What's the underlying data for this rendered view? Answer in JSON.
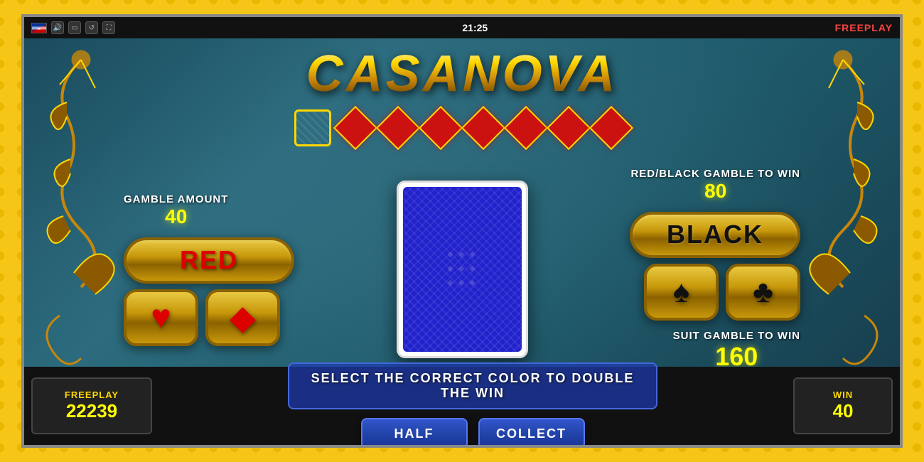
{
  "topbar": {
    "time": "21:25",
    "mode": "FREEPLAY"
  },
  "title": "CASANOVA",
  "card_history": {
    "slots": [
      {
        "type": "back",
        "label": "card-back"
      },
      {
        "type": "diamond",
        "label": "diamond-1"
      },
      {
        "type": "diamond",
        "label": "diamond-2"
      },
      {
        "type": "diamond",
        "label": "diamond-3"
      },
      {
        "type": "diamond",
        "label": "diamond-4"
      },
      {
        "type": "diamond",
        "label": "diamond-5"
      },
      {
        "type": "diamond",
        "label": "diamond-6"
      },
      {
        "type": "diamond",
        "label": "diamond-7"
      }
    ]
  },
  "gamble": {
    "amount_label": "GAMBLE AMOUNT",
    "amount_value": "40",
    "red_black_label": "RED/BLACK GAMBLE TO WIN",
    "red_black_value": "80",
    "suit_label": "SUIT GAMBLE TO WIN",
    "suit_value": "160"
  },
  "buttons": {
    "red_label": "RED",
    "black_label": "BLACK",
    "heart_symbol": "♥",
    "diamond_symbol": "◆",
    "spade_symbol": "♠",
    "club_symbol": "♣",
    "half_label": "HALF",
    "collect_label": "COLLECT"
  },
  "bottom": {
    "freeplay_label": "FREEPLAY",
    "freeplay_value": "22239",
    "message_line1": "SELECT THE CORRECT COLOR TO DOUBLE",
    "message_line2": "THE WIN",
    "win_label": "WIN",
    "win_value": "40"
  }
}
